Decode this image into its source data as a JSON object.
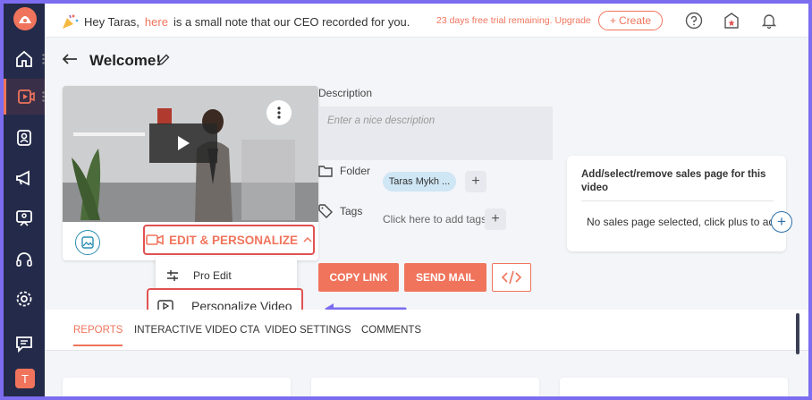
{
  "topbar": {
    "note_prefix": "Hey Taras,",
    "note_link": "here",
    "note_suffix": "is a small note that our CEO recorded for you.",
    "trial_text": "23 days free trial remaining. Upgrade",
    "create_label": "Create"
  },
  "sidebar": {
    "avatar_initial": "T",
    "items": [
      "home-icon",
      "video-icon",
      "contact-icon",
      "megaphone-icon",
      "presentation-icon",
      "headset-icon",
      "gear-icon",
      "chat-icon"
    ]
  },
  "page": {
    "title": "Welcome!"
  },
  "video": {
    "edit_personalize_label": "EDIT & PERSONALIZE"
  },
  "dropdown": {
    "pro_edit_label": "Pro Edit",
    "personalize_label": "Personalize Video"
  },
  "details": {
    "description_label": "Description",
    "description_placeholder": "Enter a nice description",
    "folder_label": "Folder",
    "folder_value": "Taras Mykh ...",
    "tags_label": "Tags",
    "tags_hint": "Click here to add tags"
  },
  "sales": {
    "title": "Add/select/remove sales page for this video",
    "empty_text": "No sales page selected, click plus to add"
  },
  "actions": {
    "copy_link": "COPY LINK",
    "send_mail": "SEND MAIL"
  },
  "tabs": {
    "reports": "REPORTS",
    "interactive": "INTERACTIVE VIDEO CTA",
    "settings": "VIDEO SETTINGS",
    "comments": "COMMENTS"
  },
  "colors": {
    "accent": "#f0745c",
    "sidebar": "#242b4a",
    "highlight_border": "#e05252",
    "arrow": "#7b6cf0"
  }
}
